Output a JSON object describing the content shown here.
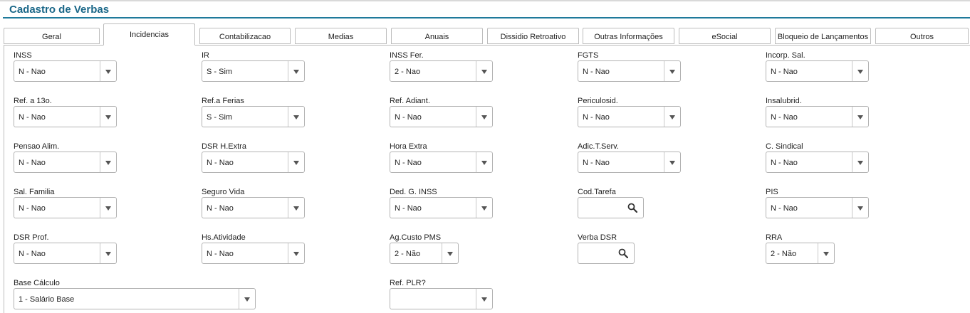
{
  "page": {
    "title": "Cadastro de Verbas"
  },
  "tabs": [
    "Geral",
    "Incidencias",
    "Contabilizacao",
    "Medias",
    "Anuais",
    "Dissidio Retroativo",
    "Outras Informações",
    "eSocial",
    "Bloqueio de Lançamentos",
    "Outros"
  ],
  "active_tab": "Incidencias",
  "fields": {
    "inss": {
      "label": "INSS",
      "value": "N - Nao"
    },
    "ir": {
      "label": "IR",
      "value": "S - Sim"
    },
    "inss_fer": {
      "label": "INSS Fer.",
      "value": "2 - Nao"
    },
    "fgts": {
      "label": "FGTS",
      "value": "N - Nao"
    },
    "incorp_sal": {
      "label": "Incorp. Sal.",
      "value": "N - Nao"
    },
    "ref_13o": {
      "label": "Ref. a 13o.",
      "value": "N - Nao"
    },
    "ref_ferias": {
      "label": "Ref.a Ferias",
      "value": "S - Sim"
    },
    "ref_adiant": {
      "label": "Ref. Adiant.",
      "value": "N - Nao"
    },
    "periculosid": {
      "label": "Periculosid.",
      "value": "N - Nao"
    },
    "insalubrid": {
      "label": "Insalubrid.",
      "value": "N - Nao"
    },
    "pensao_alim": {
      "label": "Pensao Alim.",
      "value": "N - Nao"
    },
    "dsr_hextra": {
      "label": "DSR H.Extra",
      "value": "N - Nao"
    },
    "hora_extra": {
      "label": "Hora Extra",
      "value": "N - Nao"
    },
    "adic_tserv": {
      "label": "Adic.T.Serv.",
      "value": "N - Nao"
    },
    "c_sindical": {
      "label": "C. Sindical",
      "value": "N - Nao"
    },
    "sal_familia": {
      "label": "Sal. Familia",
      "value": "N - Nao"
    },
    "seguro_vida": {
      "label": "Seguro Vida",
      "value": "N - Nao"
    },
    "ded_g_inss": {
      "label": "Ded. G. INSS",
      "value": "N - Nao"
    },
    "cod_tarefa": {
      "label": "Cod.Tarefa",
      "value": ""
    },
    "pis": {
      "label": "PIS",
      "value": "N - Nao"
    },
    "dsr_prof": {
      "label": "DSR Prof.",
      "value": "N - Nao"
    },
    "hs_atividade": {
      "label": "Hs.Atividade",
      "value": "N - Nao"
    },
    "ag_custo_pms": {
      "label": "Ag.Custo PMS",
      "value": "2 - Não"
    },
    "verba_dsr": {
      "label": "Verba DSR",
      "value": ""
    },
    "rra": {
      "label": "RRA",
      "value": "2 - Não"
    },
    "base_calculo": {
      "label": "Base Cálculo",
      "value": "1 - Salário Base"
    },
    "ref_plr": {
      "label": "Ref. PLR?",
      "value": ""
    }
  },
  "colors": {
    "title": "#1a6788",
    "accent_line": "#1f7a9b",
    "border": "#b3b3b3"
  },
  "icons": {
    "lookup": "search-icon",
    "dropdown": "chevron-down-icon"
  }
}
